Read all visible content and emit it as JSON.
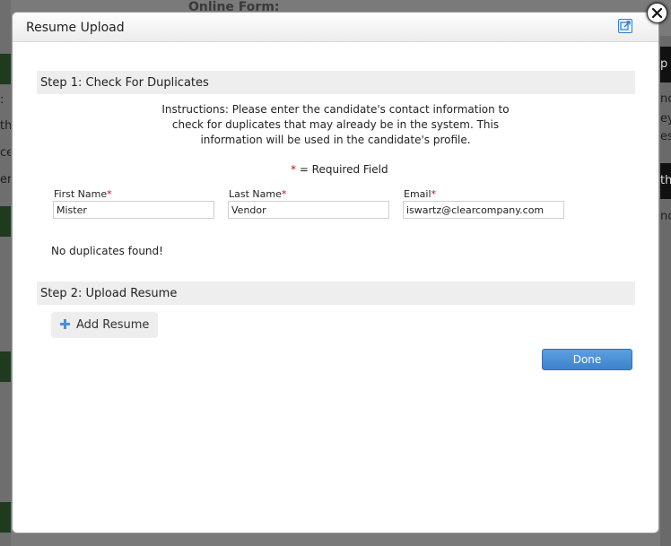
{
  "background": {
    "title_fragment": "Online Form:",
    "left_fragments": [
      ":",
      "th",
      "ce",
      "er"
    ],
    "right_fragments": [
      "p",
      "nc",
      "ey",
      "es",
      "th",
      "nc"
    ]
  },
  "modal": {
    "title": "Resume Upload",
    "step1": {
      "title": "Step 1: Check For Duplicates",
      "instructions": [
        "Instructions: Please enter the candidate's contact information to",
        "check for duplicates that may already be in the system. This",
        "information will be used in the candidate's profile."
      ],
      "required_star": "*",
      "required_text": " = Required Field",
      "fields": [
        {
          "label": "First Name",
          "star": "*",
          "value": "Mister"
        },
        {
          "label": "Last Name",
          "star": "*",
          "value": "Vendor"
        },
        {
          "label": "Email",
          "star": "*",
          "value": "iswartz@clearcompany.com"
        }
      ],
      "status": "No duplicates found!"
    },
    "step2": {
      "title": "Step 2: Upload Resume",
      "add_resume_label": "Add Resume"
    },
    "done_label": "Done"
  },
  "colors": {
    "accent": "#4a8fd6",
    "required": "#d0021b",
    "section_bg": "#eeeeee"
  },
  "icons": {
    "popout": "popout-icon",
    "close": "close-icon",
    "add": "plus-icon"
  }
}
